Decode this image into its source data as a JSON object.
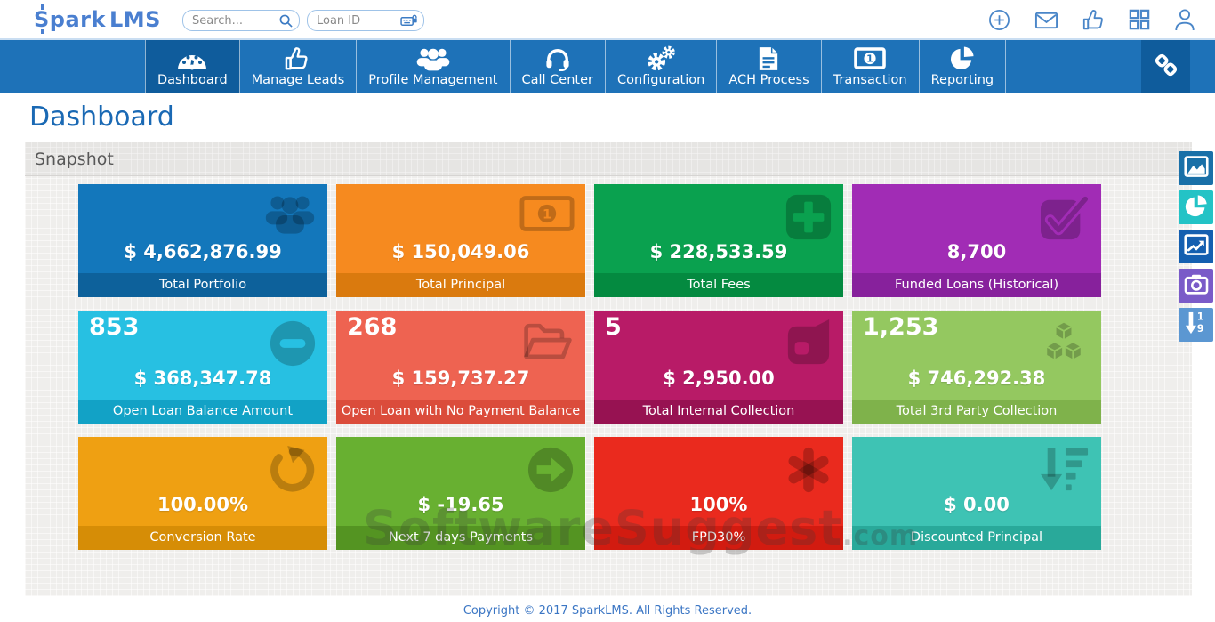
{
  "theme": {
    "brand_blue": "#4a7fd0",
    "nav_bg": "#1e72b8",
    "nav_active": "#0f5c9c",
    "header_icon_blue": "#4a86c8",
    "title_blue": "#1a69b4",
    "footer_blue": "#3b76c4"
  },
  "header": {
    "brand_first": "Spark",
    "brand_second": "LMS",
    "search_placeholder": "Search...",
    "loan_id_placeholder": "Loan ID",
    "icons": [
      "plus-circle-icon",
      "mail-icon",
      "thumbs-up-icon",
      "grid-icon",
      "user-icon"
    ]
  },
  "nav": {
    "items": [
      {
        "label": "Dashboard",
        "icon": "gauge-icon",
        "active": true
      },
      {
        "label": "Manage Leads",
        "icon": "thumbs-up-icon",
        "active": false
      },
      {
        "label": "Profile Management",
        "icon": "users-icon",
        "active": false
      },
      {
        "label": "Call Center",
        "icon": "headset-icon",
        "active": false
      },
      {
        "label": "Configuration",
        "icon": "gears-icon",
        "active": false
      },
      {
        "label": "ACH Process",
        "icon": "document-icon",
        "active": false
      },
      {
        "label": "Transaction",
        "icon": "money-icon",
        "active": false
      },
      {
        "label": "Reporting",
        "icon": "pie-chart-icon",
        "active": false
      }
    ],
    "link_button_icon": "chain-link-icon"
  },
  "page": {
    "title": "Dashboard",
    "section": "Snapshot"
  },
  "tiles": [
    {
      "value": "$ 4,662,876.99",
      "label": "Total Portfolio",
      "color": "#1377bb",
      "band": "#0d619b",
      "icon": "users-icon"
    },
    {
      "value": "$ 150,049.06",
      "label": "Total Principal",
      "color": "#f68a1f",
      "band": "#da7a0e",
      "icon": "money-bill-icon"
    },
    {
      "value": "$ 228,533.59",
      "label": "Total Fees",
      "color": "#0aa14f",
      "band": "#048a40",
      "icon": "plus-icon"
    },
    {
      "value": "8,700",
      "label": "Funded Loans (Historical)",
      "color": "#a12cb5",
      "band": "#87219c",
      "icon": "check-icon"
    },
    {
      "count": "853",
      "value": "$ 368,347.78",
      "label": "Open Loan Balance Amount",
      "color": "#27c0e2",
      "band": "#12a2c6",
      "icon": "minus-circle-icon"
    },
    {
      "count": "268",
      "value": "$ 159,737.27",
      "label": "Open Loan with No Payment Balance",
      "color": "#ee6351",
      "band": "#db4c3b",
      "icon": "folder-open-icon"
    },
    {
      "count": "5",
      "value": "$ 2,950.00",
      "label": "Total Internal Collection",
      "color": "#b81b67",
      "band": "#971252",
      "icon": "collection-icon"
    },
    {
      "count": "1,253",
      "value": "$ 746,292.38",
      "label": "Total 3rd Party Collection",
      "color": "#94c860",
      "band": "#7fb24b",
      "icon": "cubes-icon"
    },
    {
      "value": "100.00%",
      "label": "Conversion Rate",
      "color": "#efa012",
      "band": "#d68d06",
      "icon": "refresh-icon"
    },
    {
      "value": "$ -19.65",
      "label": "Next 7 days Payments",
      "color": "#68b031",
      "band": "#549422",
      "icon": "arrow-circle-right-icon"
    },
    {
      "value": "100%",
      "label": "FPD30%",
      "color": "#ea2a1e",
      "band": "#d21b10",
      "icon": "asterisk-icon"
    },
    {
      "value": "$ 0.00",
      "label": "Discounted Principal",
      "color": "#3ec3b4",
      "band": "#29a99a",
      "icon": "sort-desc-icon"
    }
  ],
  "tools": [
    {
      "icon": "area-chart-icon",
      "color": "#1970a8"
    },
    {
      "icon": "pie-chart-icon",
      "color": "#23c3c6"
    },
    {
      "icon": "line-chart-icon",
      "color": "#145fb0"
    },
    {
      "icon": "camera-icon",
      "color": "#7a5bc8"
    },
    {
      "icon": "sort-numeric-desc-icon",
      "color": "#5b97d2"
    }
  ],
  "watermark": {
    "text": "SoftwareSuggest",
    "suffix": ".com"
  },
  "footer": {
    "text": "Copyright © 2017 SparkLMS. All Rights Reserved."
  }
}
